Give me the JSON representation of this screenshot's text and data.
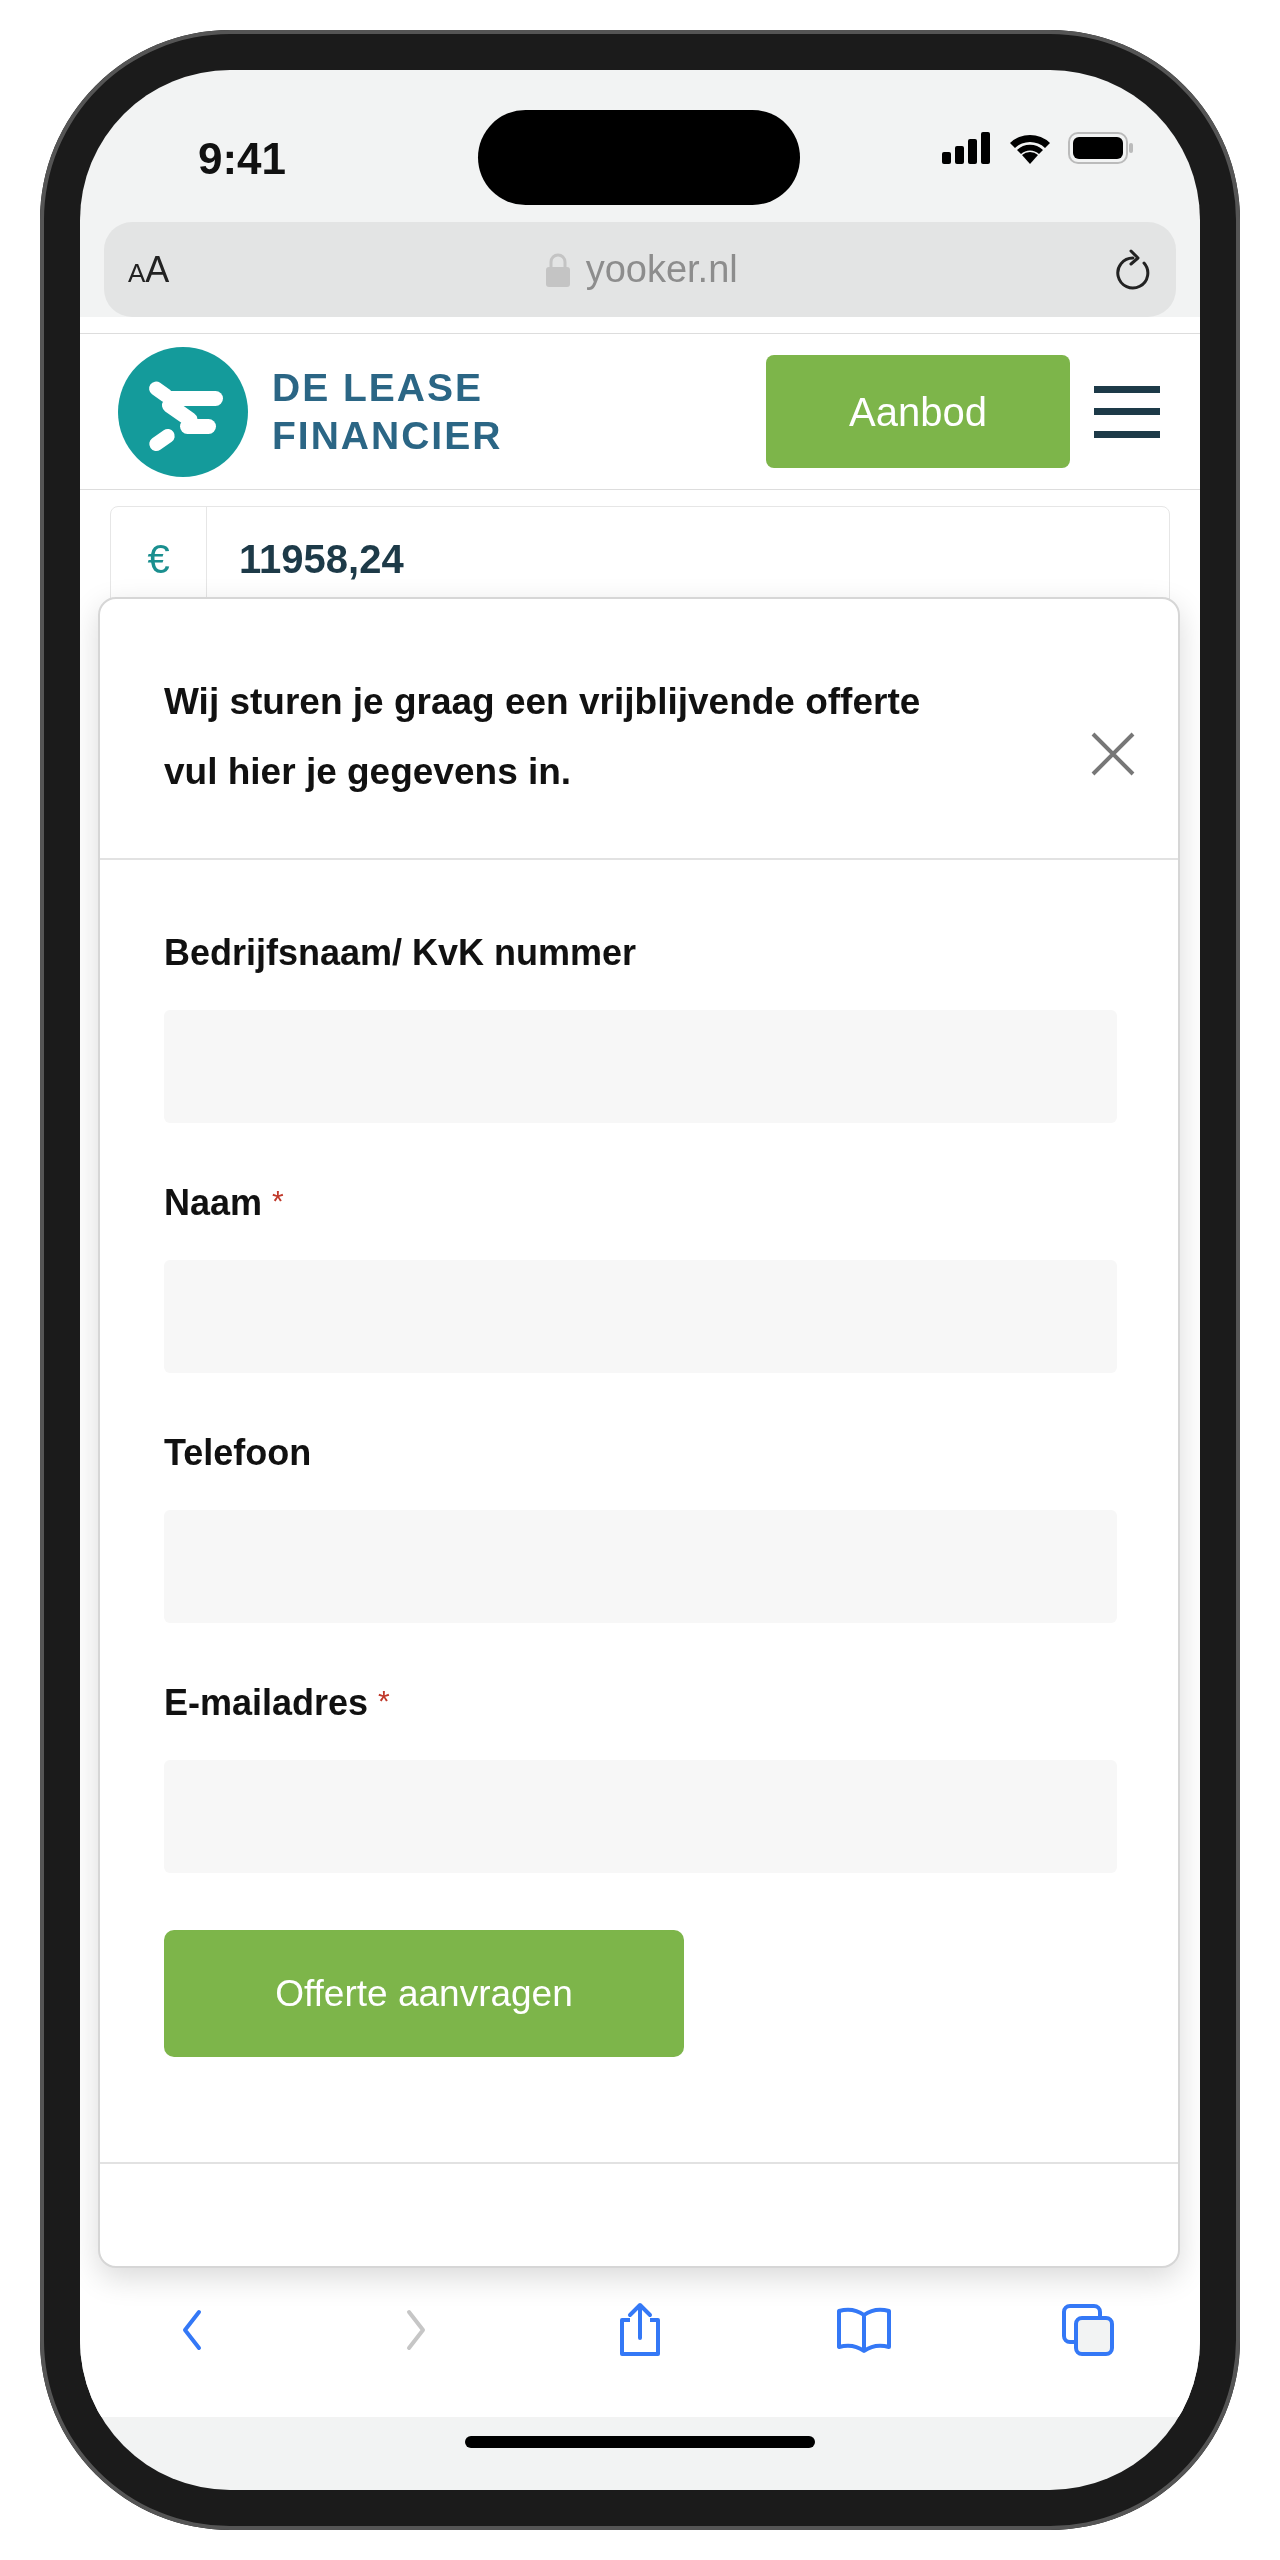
{
  "status_bar": {
    "time": "9:41"
  },
  "address_bar": {
    "text_size_button": "AA",
    "url": "yooker.nl"
  },
  "header": {
    "logo_lines": [
      "DE LEASE",
      "FINANCIER"
    ],
    "cta": "Aanbod"
  },
  "amount_field": {
    "prefix": "€",
    "value": "11958,24"
  },
  "modal": {
    "title_lines": [
      "Wij sturen je graag een vrijblijvende offerte",
      "vul hier je gegevens in."
    ],
    "fields": [
      {
        "label": "Bedrijfsnaam/ KvK nummer"
      },
      {
        "label": "Naam",
        "required_mark": "*"
      },
      {
        "label": "Telefoon"
      },
      {
        "label": "E-mailadres",
        "required_mark": "*"
      }
    ],
    "submit": "Offerte aanvragen"
  },
  "toolbar": [
    {
      "kind": "back",
      "disabled": false
    },
    {
      "kind": "forward",
      "disabled": true
    },
    {
      "kind": "share",
      "disabled": false
    },
    {
      "kind": "bookmarks",
      "disabled": false
    },
    {
      "kind": "tabs",
      "disabled": false
    }
  ]
}
